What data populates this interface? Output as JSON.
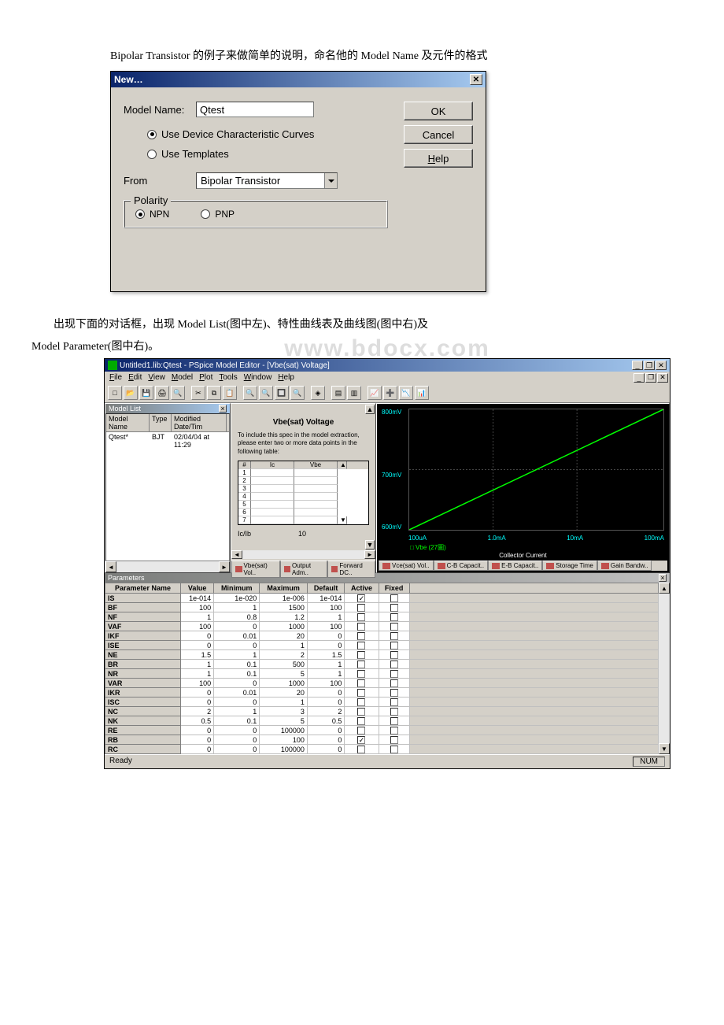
{
  "intro": "Bipolar Transistor 的例子来做简单的说明，命名他的 Model Name 及元件的格式",
  "dialog1": {
    "title": "New…",
    "model_name_label": "Model Name:",
    "model_name_value": "Qtest",
    "opt_curves": "Use Device Characteristic Curves",
    "opt_templates": "Use Templates",
    "from_label": "From",
    "from_value": "Bipolar Transistor",
    "polarity_legend": "Polarity",
    "npn": "NPN",
    "pnp": "PNP",
    "ok": "OK",
    "cancel": "Cancel",
    "help": "Help"
  },
  "mid1": "出现下面的对话框，出现 Model List(图中左)、特性曲线表及曲线图(图中右)及",
  "mid2": "Model Parameter(图中右)。",
  "watermark": "www.bdocx.com",
  "mainwin": {
    "title": "Untitled1.lib:Qtest - PSpice Model Editor - [Vbe(sat) Voltage]",
    "menus": [
      "File",
      "Edit",
      "View",
      "Model",
      "Plot",
      "Tools",
      "Window",
      "Help"
    ],
    "modellist": {
      "title": "Model List",
      "cols": [
        "Model Name",
        "Type",
        "Modified Date/Tim"
      ],
      "row": [
        "Qtest*",
        "BJT",
        "02/04/04 at 11:29"
      ]
    },
    "spec": {
      "title": "Vbe(sat) Voltage",
      "text": "To include this spec in the model extraction, please enter two or more data points in the following table:",
      "col_i": "#",
      "col_ic": "Ic",
      "col_vbe": "Vbe",
      "icib_label": "Ic/Ib",
      "icib_value": "10"
    },
    "tabs_mid": [
      "Vbe(sat) Vol..",
      "Output Adm..",
      "Forward DC.."
    ],
    "tabs_right": [
      "Vce(sat) Vol..",
      "C-B Capacit..",
      "E-B Capacit..",
      "Storage Time",
      "Gain Bandw.."
    ],
    "chart": {
      "ylabels": [
        "800mV",
        "700mV",
        "600mV"
      ],
      "xlabels": [
        "100uA",
        "1.0mA",
        "10mA",
        "100mA"
      ],
      "xaxis_note": "□ Vbe (27圖)",
      "xtitle": "Collector Current"
    },
    "params": {
      "title": "Parameters",
      "cols": [
        "Parameter Name",
        "Value",
        "Minimum",
        "Maximum",
        "Default",
        "Active",
        "Fixed"
      ],
      "rows": [
        {
          "n": "IS",
          "v": "1e-014",
          "min": "1e-020",
          "max": "1e-006",
          "def": "1e-014",
          "a": true,
          "f": false
        },
        {
          "n": "BF",
          "v": "100",
          "min": "1",
          "max": "1500",
          "def": "100",
          "a": false,
          "f": false
        },
        {
          "n": "NF",
          "v": "1",
          "min": "0.8",
          "max": "1.2",
          "def": "1",
          "a": false,
          "f": false
        },
        {
          "n": "VAF",
          "v": "100",
          "min": "0",
          "max": "1000",
          "def": "100",
          "a": false,
          "f": false
        },
        {
          "n": "IKF",
          "v": "0",
          "min": "0.01",
          "max": "20",
          "def": "0",
          "a": false,
          "f": false
        },
        {
          "n": "ISE",
          "v": "0",
          "min": "0",
          "max": "1",
          "def": "0",
          "a": false,
          "f": false
        },
        {
          "n": "NE",
          "v": "1.5",
          "min": "1",
          "max": "2",
          "def": "1.5",
          "a": false,
          "f": false
        },
        {
          "n": "BR",
          "v": "1",
          "min": "0.1",
          "max": "500",
          "def": "1",
          "a": false,
          "f": false
        },
        {
          "n": "NR",
          "v": "1",
          "min": "0.1",
          "max": "5",
          "def": "1",
          "a": false,
          "f": false
        },
        {
          "n": "VAR",
          "v": "100",
          "min": "0",
          "max": "1000",
          "def": "100",
          "a": false,
          "f": false
        },
        {
          "n": "IKR",
          "v": "0",
          "min": "0.01",
          "max": "20",
          "def": "0",
          "a": false,
          "f": false
        },
        {
          "n": "ISC",
          "v": "0",
          "min": "0",
          "max": "1",
          "def": "0",
          "a": false,
          "f": false
        },
        {
          "n": "NC",
          "v": "2",
          "min": "1",
          "max": "3",
          "def": "2",
          "a": false,
          "f": false
        },
        {
          "n": "NK",
          "v": "0.5",
          "min": "0.1",
          "max": "5",
          "def": "0.5",
          "a": false,
          "f": false
        },
        {
          "n": "RE",
          "v": "0",
          "min": "0",
          "max": "100000",
          "def": "0",
          "a": false,
          "f": false
        },
        {
          "n": "RB",
          "v": "0",
          "min": "0",
          "max": "100",
          "def": "0",
          "a": true,
          "f": false
        },
        {
          "n": "RC",
          "v": "0",
          "min": "0",
          "max": "100000",
          "def": "0",
          "a": false,
          "f": false
        }
      ]
    },
    "status_left": "Ready",
    "status_right": "NUM"
  },
  "chart_data": {
    "type": "line",
    "title": "Vbe(sat) Voltage",
    "xlabel": "Collector Current",
    "ylabel": "Vbe",
    "x": [
      "100uA",
      "1.0mA",
      "10mA",
      "100mA"
    ],
    "ylim_mv": [
      600,
      800
    ],
    "series": [
      {
        "name": "Vbe (27°C)",
        "values_mv": [
          600,
          670,
          740,
          800
        ]
      }
    ],
    "note": "log-scale x-axis; single trace rising diagonally"
  }
}
